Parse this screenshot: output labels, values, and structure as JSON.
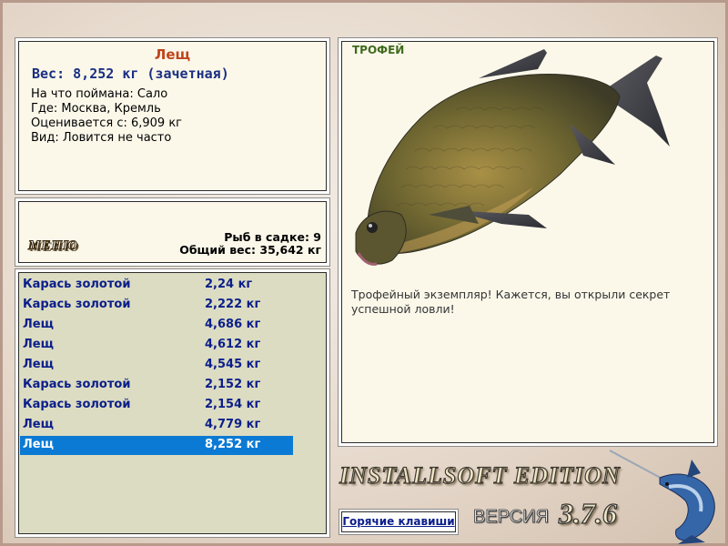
{
  "fish_info": {
    "name": "Лещ",
    "weight": "Вес: 8,252 кг (зачетная)",
    "details": [
      "На что поймана: Сало",
      "Где: Москва, Кремль",
      "Оценивается с: 6,909 кг",
      "Вид: Ловится не часто"
    ]
  },
  "menu": {
    "label": "МЕНЮ",
    "fish_count": "Рыб в садке: 9",
    "total_weight": "Общий вес: 35,642 кг"
  },
  "catch_list": [
    {
      "name": "Карась золотой",
      "weight": "2,24 кг"
    },
    {
      "name": "Карась золотой",
      "weight": "2,222 кг"
    },
    {
      "name": "Лещ",
      "weight": "4,686 кг"
    },
    {
      "name": "Лещ",
      "weight": "4,612 кг"
    },
    {
      "name": "Лещ",
      "weight": "4,545 кг"
    },
    {
      "name": "Карась золотой",
      "weight": "2,152 кг"
    },
    {
      "name": "Карась золотой",
      "weight": "2,154 кг"
    },
    {
      "name": "Лещ",
      "weight": "4,779 кг"
    },
    {
      "name": "Лещ",
      "weight": "8,252 кг"
    }
  ],
  "selected_index": 8,
  "trophy": {
    "tag": "ТРОФЕЙ",
    "description": "Трофейный экземпляр! Кажется, вы открыли секрет успешной ловли!"
  },
  "footer": {
    "brand": "INSTALLSOFT EDITION",
    "version_label": "ВЕРСИЯ",
    "version_number": "3.7.6",
    "hotkeys_label": "Горячие клавиши"
  },
  "colors": {
    "selection": "#0b7ad4",
    "fish_name": "#c0441a",
    "list_text": "#0b1e8a",
    "trophy_tag": "#3f6b1e"
  }
}
